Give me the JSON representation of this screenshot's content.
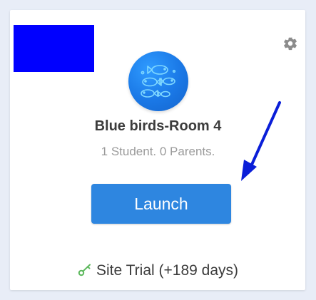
{
  "class_card": {
    "name": "Blue birds-Room 4",
    "meta": "1 Student. 0 Parents.",
    "launch_label": "Launch",
    "trial_label": "Site Trial (+189 days)"
  },
  "icons": {
    "settings": "gear-icon",
    "avatar": "fish-avatar-icon",
    "trial": "key-icon"
  },
  "colors": {
    "launch_button": "#2e86e0",
    "avatar": "#1a78e6",
    "trial_key": "#5cb85c",
    "annotation_arrow": "#0a1ed8",
    "redaction": "#0000ff"
  }
}
